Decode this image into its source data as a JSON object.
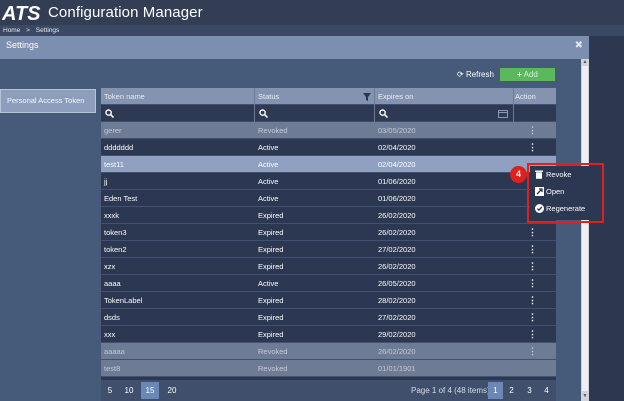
{
  "app": {
    "logo_text": "ATS",
    "title": "Configuration Manager"
  },
  "breadcrumb": {
    "home": "Home",
    "separator": ">",
    "current": "Settings"
  },
  "settings": {
    "title": "Settings",
    "close_icon": "close-icon"
  },
  "side_nav": {
    "items": [
      {
        "label": "Personal Access Token",
        "selected": true
      }
    ]
  },
  "toolbar": {
    "refresh_label": "Refresh",
    "refresh_icon": "refresh-icon",
    "add_label": "Add",
    "add_icon": "plus-icon",
    "add_color": "#5cb85c"
  },
  "table": {
    "columns": [
      {
        "label": "Token name"
      },
      {
        "label": "Status",
        "filter_icon": "filter-icon"
      },
      {
        "label": "Expires on"
      },
      {
        "label": "Action"
      }
    ],
    "rows": [
      {
        "name": "gerer",
        "status": "Revoked",
        "expires": "03/05/2020"
      },
      {
        "name": "ddddddd",
        "status": "Active",
        "expires": "02/04/2020"
      },
      {
        "name": "test11",
        "status": "Active",
        "expires": "02/04/2020",
        "selected": true
      },
      {
        "name": "jj",
        "status": "Active",
        "expires": "01/06/2020"
      },
      {
        "name": "Eden Test",
        "status": "Active",
        "expires": "01/06/2020"
      },
      {
        "name": "xxxk",
        "status": "Expired",
        "expires": "26/02/2020"
      },
      {
        "name": "token3",
        "status": "Expired",
        "expires": "26/02/2020"
      },
      {
        "name": "token2",
        "status": "Expired",
        "expires": "27/02/2020"
      },
      {
        "name": "xzx",
        "status": "Expired",
        "expires": "26/02/2020"
      },
      {
        "name": "aaaa",
        "status": "Active",
        "expires": "26/05/2020"
      },
      {
        "name": "TokenLabel",
        "status": "Expired",
        "expires": "28/02/2020"
      },
      {
        "name": "dsds",
        "status": "Expired",
        "expires": "27/02/2020"
      },
      {
        "name": "xxx",
        "status": "Expired",
        "expires": "29/02/2020"
      },
      {
        "name": "aaaaa",
        "status": "Revoked",
        "expires": "26/02/2020"
      },
      {
        "name": "test8",
        "status": "Revoked",
        "expires": "01/01/1901"
      }
    ]
  },
  "context_menu": {
    "items": [
      {
        "label": "Revoke",
        "icon": "trash-icon"
      },
      {
        "label": "Open",
        "icon": "open-icon"
      },
      {
        "label": "Regenerate",
        "icon": "check-circle-icon"
      }
    ],
    "highlight_color": "#e0201c"
  },
  "step_badge": "4",
  "pager": {
    "sizes": [
      "5",
      "10",
      "15",
      "20"
    ],
    "active_size": "15",
    "info": "Page 1 of 4 (48 items)",
    "pages": [
      "1",
      "2",
      "3",
      "4"
    ],
    "active_page": "1"
  }
}
